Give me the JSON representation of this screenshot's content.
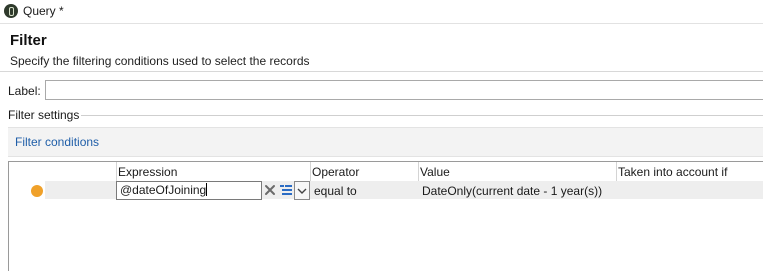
{
  "window": {
    "title": "Query *"
  },
  "header": {
    "title": "Filter",
    "subtitle": "Specify the filtering conditions used to select the records"
  },
  "label_field": {
    "label": "Label:",
    "value": ""
  },
  "filter_settings": {
    "group_title": "Filter settings",
    "conditions_link": "Filter conditions"
  },
  "grid": {
    "columns": [
      "Expression",
      "Operator",
      "Value",
      "Taken into account if"
    ],
    "rows": [
      {
        "expression": "@dateOfJoining",
        "operator": "equal to",
        "value": "DateOnly(current date - 1 year(s))",
        "taken_into_account_if": ""
      }
    ]
  },
  "colors": {
    "status_dot": "#f0a12a",
    "link": "#1f5ea8",
    "editor_icon": "#2b6cc4"
  },
  "icons": {
    "clear": "close-icon",
    "expression_editor": "expression-editor-icon",
    "dropdown": "chevron-down-icon"
  }
}
